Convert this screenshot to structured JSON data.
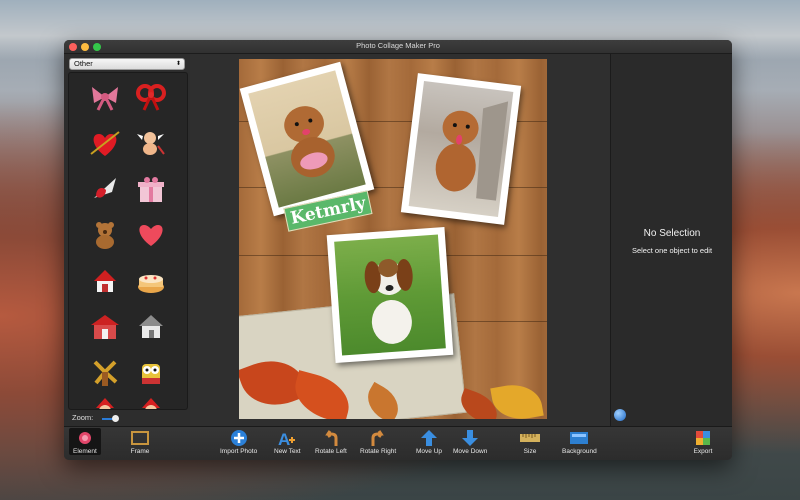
{
  "window": {
    "title": "Photo Collage Maker Pro"
  },
  "library": {
    "category": "Other",
    "zoom_label": "Zoom:",
    "items": [
      "bow-icon",
      "red-bow-icon",
      "heart-arrow-icon",
      "cupid-icon",
      "cracked-heart-icon",
      "gift-box-icon",
      "teddy-bear-icon",
      "heart-icon",
      "red-house-icon",
      "cake-icon",
      "doghouse-icon",
      "small-house-icon",
      "windmill-icon",
      "owl-icon",
      "santa-icon",
      "santa-2-icon"
    ]
  },
  "canvas": {
    "text_label": "Ketmrly"
  },
  "inspector": {
    "title": "No Selection",
    "subtitle": "Select one object to edit"
  },
  "toolbar": {
    "element": "Element",
    "frame": "Frame",
    "import_photo": "Import Photo",
    "new_text": "New Text",
    "rotate_left": "Rotate Left",
    "rotate_right": "Rotate Right",
    "move_up": "Move Up",
    "move_down": "Move Down",
    "size": "Size",
    "background": "Background",
    "export": "Export"
  }
}
